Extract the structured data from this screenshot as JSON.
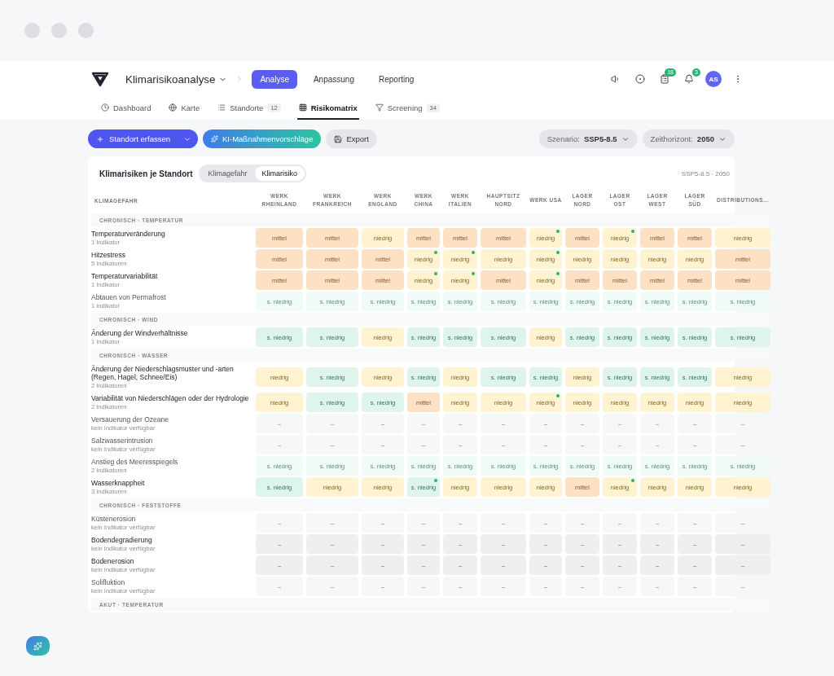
{
  "app": {
    "title": "Klimarisikoanalyse",
    "tabs": [
      {
        "label": "Analyse",
        "selected": true
      },
      {
        "label": "Anpassung",
        "selected": false
      },
      {
        "label": "Reporting",
        "selected": false
      }
    ],
    "badges": {
      "tasks": "18",
      "notifications": "3"
    },
    "avatar": "AS"
  },
  "subtabs": [
    {
      "label": "Dashboard",
      "selected": false
    },
    {
      "label": "Karte",
      "selected": false
    },
    {
      "label": "Standorte",
      "count": "12",
      "selected": false
    },
    {
      "label": "Risikomatrix",
      "selected": true
    },
    {
      "label": "Screening",
      "count": "34",
      "selected": false
    }
  ],
  "toolbar": {
    "add": "Standort erfassen",
    "ai": "KI-Maßnahmenvorschläge",
    "export": "Export",
    "scenario_label": "Szenario:",
    "scenario": "SSP5-8.5",
    "horizon_label": "Zeithorizont:",
    "horizon": "2050"
  },
  "card": {
    "title": "Klimarisiken je Standort",
    "toggle": [
      {
        "label": "Klimagefahr",
        "selected": false
      },
      {
        "label": "Klimarisiko",
        "selected": true
      }
    ],
    "meta": "SSP5-8.5 · 2050",
    "first_column": "KLIMAGEFAHR",
    "columns": [
      "WERK RHEINLAND",
      "WERK FRANKREICH",
      "WERK ENGLAND",
      "WERK CHINA",
      "WERK ITALIEN",
      "HAUPTSITZ NORD",
      "WERK USA",
      "LAGER NORD",
      "LAGER OST",
      "LAGER WEST",
      "LAGER SÜD",
      "DISTRIBUTIONS..."
    ],
    "groups": [
      {
        "title": "CHRONISCH · TEMPERATUR",
        "rows": [
          {
            "label": "Temperaturveränderung",
            "sub": "1 Indikator",
            "faded": false,
            "cells": [
              {
                "text": "mittel",
                "kind": "medium",
                "flag": false
              },
              {
                "text": "mittel",
                "kind": "medium",
                "flag": false
              },
              {
                "text": "niedrig",
                "kind": "low",
                "flag": false
              },
              {
                "text": "mittel",
                "kind": "medium",
                "flag": false
              },
              {
                "text": "mittel",
                "kind": "medium",
                "flag": false
              },
              {
                "text": "mittel",
                "kind": "medium",
                "flag": false
              },
              {
                "text": "niedrig",
                "kind": "low",
                "flag": true
              },
              {
                "text": "mittel",
                "kind": "medium",
                "flag": false
              },
              {
                "text": "niedrig",
                "kind": "low",
                "flag": true
              },
              {
                "text": "mittel",
                "kind": "medium",
                "flag": false
              },
              {
                "text": "mittel",
                "kind": "medium",
                "flag": false
              },
              {
                "text": "niedrig",
                "kind": "low",
                "flag": false
              }
            ]
          },
          {
            "label": "Hitzestress",
            "sub": "5 Indikatoren",
            "faded": false,
            "cells": [
              {
                "text": "mittel",
                "kind": "medium",
                "flag": false
              },
              {
                "text": "mittel",
                "kind": "medium",
                "flag": false
              },
              {
                "text": "mittel",
                "kind": "medium",
                "flag": false
              },
              {
                "text": "niedrig",
                "kind": "low",
                "flag": true
              },
              {
                "text": "niedrig",
                "kind": "low",
                "flag": true
              },
              {
                "text": "niedrig",
                "kind": "low",
                "flag": false
              },
              {
                "text": "niedrig",
                "kind": "low",
                "flag": true
              },
              {
                "text": "niedrig",
                "kind": "low",
                "flag": false
              },
              {
                "text": "niedrig",
                "kind": "low",
                "flag": false
              },
              {
                "text": "niedrig",
                "kind": "low",
                "flag": false
              },
              {
                "text": "niedrig",
                "kind": "low",
                "flag": false
              },
              {
                "text": "mittel",
                "kind": "medium",
                "flag": false
              }
            ]
          },
          {
            "label": "Temperaturvariabilität",
            "sub": "1 Indikator",
            "faded": false,
            "cells": [
              {
                "text": "mittel",
                "kind": "medium",
                "flag": false
              },
              {
                "text": "mittel",
                "kind": "medium",
                "flag": false
              },
              {
                "text": "mittel",
                "kind": "medium",
                "flag": false
              },
              {
                "text": "niedrig",
                "kind": "low",
                "flag": true
              },
              {
                "text": "niedrig",
                "kind": "low",
                "flag": true
              },
              {
                "text": "mittel",
                "kind": "medium",
                "flag": false
              },
              {
                "text": "niedrig",
                "kind": "low",
                "flag": true
              },
              {
                "text": "mittel",
                "kind": "medium",
                "flag": false
              },
              {
                "text": "mittel",
                "kind": "medium",
                "flag": false
              },
              {
                "text": "mittel",
                "kind": "medium",
                "flag": false
              },
              {
                "text": "mittel",
                "kind": "medium",
                "flag": false
              },
              {
                "text": "mittel",
                "kind": "medium",
                "flag": false
              }
            ]
          },
          {
            "label": "Abtauen von Permafrost",
            "sub": "1 Indikator",
            "faded": true,
            "cells": [
              {
                "text": "s. niedrig",
                "kind": "very_low",
                "flag": false
              },
              {
                "text": "s. niedrig",
                "kind": "very_low",
                "flag": false
              },
              {
                "text": "s. niedrig",
                "kind": "very_low",
                "flag": false
              },
              {
                "text": "s. niedrig",
                "kind": "very_low",
                "flag": false
              },
              {
                "text": "s. niedrig",
                "kind": "very_low",
                "flag": false
              },
              {
                "text": "s. niedrig",
                "kind": "very_low",
                "flag": false
              },
              {
                "text": "s. niedrig",
                "kind": "very_low",
                "flag": false
              },
              {
                "text": "s. niedrig",
                "kind": "very_low",
                "flag": false
              },
              {
                "text": "s. niedrig",
                "kind": "very_low",
                "flag": false
              },
              {
                "text": "s. niedrig",
                "kind": "very_low",
                "flag": false
              },
              {
                "text": "s. niedrig",
                "kind": "very_low",
                "flag": false
              },
              {
                "text": "s. niedrig",
                "kind": "very_low",
                "flag": false
              }
            ]
          }
        ]
      },
      {
        "title": "CHRONISCH · WIND",
        "rows": [
          {
            "label": "Änderung der Windverhältnisse",
            "sub": "1 Indikator",
            "faded": false,
            "cells": [
              {
                "text": "s. niedrig",
                "kind": "very_low",
                "flag": false
              },
              {
                "text": "s. niedrig",
                "kind": "very_low",
                "flag": false
              },
              {
                "text": "niedrig",
                "kind": "low",
                "flag": false
              },
              {
                "text": "s. niedrig",
                "kind": "very_low",
                "flag": false
              },
              {
                "text": "s. niedrig",
                "kind": "very_low",
                "flag": false
              },
              {
                "text": "s. niedrig",
                "kind": "very_low",
                "flag": false
              },
              {
                "text": "niedrig",
                "kind": "low",
                "flag": false
              },
              {
                "text": "s. niedrig",
                "kind": "very_low",
                "flag": false
              },
              {
                "text": "s. niedrig",
                "kind": "very_low",
                "flag": false
              },
              {
                "text": "s. niedrig",
                "kind": "very_low",
                "flag": false
              },
              {
                "text": "s. niedrig",
                "kind": "very_low",
                "flag": false
              },
              {
                "text": "s. niedrig",
                "kind": "very_low",
                "flag": false
              }
            ]
          }
        ]
      },
      {
        "title": "CHRONISCH · WASSER",
        "rows": [
          {
            "label": "Änderung der Niederschlagsmuster und -arten (Regen, Hagel, Schnee/Eis)",
            "sub": "2 Indikatoren",
            "faded": false,
            "cells": [
              {
                "text": "niedrig",
                "kind": "low",
                "flag": false
              },
              {
                "text": "s. niedrig",
                "kind": "very_low",
                "flag": false
              },
              {
                "text": "niedrig",
                "kind": "low",
                "flag": false
              },
              {
                "text": "s. niedrig",
                "kind": "very_low",
                "flag": false
              },
              {
                "text": "niedrig",
                "kind": "low",
                "flag": false
              },
              {
                "text": "s. niedrig",
                "kind": "very_low",
                "flag": false
              },
              {
                "text": "s. niedrig",
                "kind": "very_low",
                "flag": false
              },
              {
                "text": "niedrig",
                "kind": "low",
                "flag": false
              },
              {
                "text": "s. niedrig",
                "kind": "very_low",
                "flag": false
              },
              {
                "text": "s. niedrig",
                "kind": "very_low",
                "flag": false
              },
              {
                "text": "s. niedrig",
                "kind": "very_low",
                "flag": false
              },
              {
                "text": "niedrig",
                "kind": "low",
                "flag": false
              }
            ]
          },
          {
            "label": "Variabilität von Niederschlägen oder der Hydrologie",
            "sub": "2 Indikatoren",
            "faded": false,
            "cells": [
              {
                "text": "niedrig",
                "kind": "low",
                "flag": false
              },
              {
                "text": "s. niedrig",
                "kind": "very_low",
                "flag": false
              },
              {
                "text": "s. niedrig",
                "kind": "very_low",
                "flag": false
              },
              {
                "text": "mittel",
                "kind": "medium",
                "flag": false
              },
              {
                "text": "niedrig",
                "kind": "low",
                "flag": false
              },
              {
                "text": "niedrig",
                "kind": "low",
                "flag": false
              },
              {
                "text": "niedrig",
                "kind": "low",
                "flag": true
              },
              {
                "text": "niedrig",
                "kind": "low",
                "flag": false
              },
              {
                "text": "niedrig",
                "kind": "low",
                "flag": false
              },
              {
                "text": "niedrig",
                "kind": "low",
                "flag": false
              },
              {
                "text": "niedrig",
                "kind": "low",
                "flag": false
              },
              {
                "text": "niedrig",
                "kind": "low",
                "flag": false
              }
            ]
          },
          {
            "label": "Versauerung der Ozeane",
            "sub": "kein Indikator verfügbar",
            "faded": true,
            "cells": [
              {
                "text": "–",
                "kind": "none",
                "flag": false
              },
              {
                "text": "–",
                "kind": "none",
                "flag": false
              },
              {
                "text": "–",
                "kind": "none",
                "flag": false
              },
              {
                "text": "–",
                "kind": "none",
                "flag": false
              },
              {
                "text": "–",
                "kind": "none",
                "flag": false
              },
              {
                "text": "–",
                "kind": "none",
                "flag": false
              },
              {
                "text": "–",
                "kind": "none",
                "flag": false
              },
              {
                "text": "–",
                "kind": "none",
                "flag": false
              },
              {
                "text": "–",
                "kind": "none",
                "flag": false
              },
              {
                "text": "–",
                "kind": "none",
                "flag": false
              },
              {
                "text": "–",
                "kind": "none",
                "flag": false
              },
              {
                "text": "–",
                "kind": "none",
                "flag": false
              }
            ]
          },
          {
            "label": "Salzwasserintrusion",
            "sub": "kein Indikator verfügbar",
            "faded": true,
            "cells": [
              {
                "text": "–",
                "kind": "none",
                "flag": false
              },
              {
                "text": "–",
                "kind": "none",
                "flag": false
              },
              {
                "text": "–",
                "kind": "none",
                "flag": false
              },
              {
                "text": "–",
                "kind": "none",
                "flag": false
              },
              {
                "text": "–",
                "kind": "none",
                "flag": false
              },
              {
                "text": "–",
                "kind": "none",
                "flag": false
              },
              {
                "text": "–",
                "kind": "none",
                "flag": false
              },
              {
                "text": "–",
                "kind": "none",
                "flag": false
              },
              {
                "text": "–",
                "kind": "none",
                "flag": false
              },
              {
                "text": "–",
                "kind": "none",
                "flag": false
              },
              {
                "text": "–",
                "kind": "none",
                "flag": false
              },
              {
                "text": "–",
                "kind": "none",
                "flag": false
              }
            ]
          },
          {
            "label": "Anstieg des Meeresspiegels",
            "sub": "2 Indikatoren",
            "faded": true,
            "cells": [
              {
                "text": "s. niedrig",
                "kind": "very_low",
                "flag": false
              },
              {
                "text": "s. niedrig",
                "kind": "very_low",
                "flag": false
              },
              {
                "text": "s. niedrig",
                "kind": "very_low",
                "flag": false
              },
              {
                "text": "s. niedrig",
                "kind": "very_low",
                "flag": false
              },
              {
                "text": "s. niedrig",
                "kind": "very_low",
                "flag": false
              },
              {
                "text": "s. niedrig",
                "kind": "very_low",
                "flag": false
              },
              {
                "text": "s. niedrig",
                "kind": "very_low",
                "flag": false
              },
              {
                "text": "s. niedrig",
                "kind": "very_low",
                "flag": false
              },
              {
                "text": "s. niedrig",
                "kind": "very_low",
                "flag": false
              },
              {
                "text": "s. niedrig",
                "kind": "very_low",
                "flag": false
              },
              {
                "text": "s. niedrig",
                "kind": "very_low",
                "flag": false
              },
              {
                "text": "s. niedrig",
                "kind": "very_low",
                "flag": false
              }
            ]
          },
          {
            "label": "Wasserknappheit",
            "sub": "3 Indikatoren",
            "faded": false,
            "cells": [
              {
                "text": "s. niedrig",
                "kind": "very_low",
                "flag": false
              },
              {
                "text": "niedrig",
                "kind": "low",
                "flag": false
              },
              {
                "text": "niedrig",
                "kind": "low",
                "flag": false
              },
              {
                "text": "s. niedrig",
                "kind": "very_low",
                "flag": true
              },
              {
                "text": "niedrig",
                "kind": "low",
                "flag": false
              },
              {
                "text": "niedrig",
                "kind": "low",
                "flag": false
              },
              {
                "text": "niedrig",
                "kind": "low",
                "flag": false
              },
              {
                "text": "mittel",
                "kind": "medium",
                "flag": false
              },
              {
                "text": "niedrig",
                "kind": "low",
                "flag": true
              },
              {
                "text": "niedrig",
                "kind": "low",
                "flag": false
              },
              {
                "text": "niedrig",
                "kind": "low",
                "flag": false
              },
              {
                "text": "niedrig",
                "kind": "low",
                "flag": false
              }
            ]
          }
        ]
      },
      {
        "title": "CHRONISCH · FESTSTOFFE",
        "rows": [
          {
            "label": "Küstenerosion",
            "sub": "kein Indikator verfügbar",
            "faded": true,
            "cells": [
              {
                "text": "–",
                "kind": "none",
                "flag": false
              },
              {
                "text": "–",
                "kind": "none",
                "flag": false
              },
              {
                "text": "–",
                "kind": "none",
                "flag": false
              },
              {
                "text": "–",
                "kind": "none",
                "flag": false
              },
              {
                "text": "–",
                "kind": "none",
                "flag": false
              },
              {
                "text": "–",
                "kind": "none",
                "flag": false
              },
              {
                "text": "–",
                "kind": "none",
                "flag": false
              },
              {
                "text": "–",
                "kind": "none",
                "flag": false
              },
              {
                "text": "–",
                "kind": "none",
                "flag": false
              },
              {
                "text": "–",
                "kind": "none",
                "flag": false
              },
              {
                "text": "–",
                "kind": "none",
                "flag": false
              },
              {
                "text": "–",
                "kind": "none",
                "flag": false
              }
            ]
          },
          {
            "label": "Bodendegradierung",
            "sub": "kein Indikator verfügbar",
            "faded": false,
            "cells": [
              {
                "text": "–",
                "kind": "none",
                "flag": false
              },
              {
                "text": "–",
                "kind": "none",
                "flag": false
              },
              {
                "text": "–",
                "kind": "none",
                "flag": false
              },
              {
                "text": "–",
                "kind": "none",
                "flag": false
              },
              {
                "text": "–",
                "kind": "none",
                "flag": false
              },
              {
                "text": "–",
                "kind": "none",
                "flag": false
              },
              {
                "text": "–",
                "kind": "none",
                "flag": false
              },
              {
                "text": "–",
                "kind": "none",
                "flag": false
              },
              {
                "text": "–",
                "kind": "none",
                "flag": false
              },
              {
                "text": "–",
                "kind": "none",
                "flag": false
              },
              {
                "text": "–",
                "kind": "none",
                "flag": false
              },
              {
                "text": "–",
                "kind": "none",
                "flag": false
              }
            ]
          },
          {
            "label": "Bodenerosion",
            "sub": "kein Indikator verfügbar",
            "faded": false,
            "cells": [
              {
                "text": "–",
                "kind": "none",
                "flag": false
              },
              {
                "text": "–",
                "kind": "none",
                "flag": false
              },
              {
                "text": "–",
                "kind": "none",
                "flag": false
              },
              {
                "text": "–",
                "kind": "none",
                "flag": false
              },
              {
                "text": "–",
                "kind": "none",
                "flag": false
              },
              {
                "text": "–",
                "kind": "none",
                "flag": false
              },
              {
                "text": "–",
                "kind": "none",
                "flag": false
              },
              {
                "text": "–",
                "kind": "none",
                "flag": false
              },
              {
                "text": "–",
                "kind": "none",
                "flag": false
              },
              {
                "text": "–",
                "kind": "none",
                "flag": false
              },
              {
                "text": "–",
                "kind": "none",
                "flag": false
              },
              {
                "text": "–",
                "kind": "none",
                "flag": false
              }
            ]
          },
          {
            "label": "Solifluktion",
            "sub": "kein Indikator verfügbar",
            "faded": true,
            "cells": [
              {
                "text": "–",
                "kind": "none",
                "flag": false
              },
              {
                "text": "–",
                "kind": "none",
                "flag": false
              },
              {
                "text": "–",
                "kind": "none",
                "flag": false
              },
              {
                "text": "–",
                "kind": "none",
                "flag": false
              },
              {
                "text": "–",
                "kind": "none",
                "flag": false
              },
              {
                "text": "–",
                "kind": "none",
                "flag": false
              },
              {
                "text": "–",
                "kind": "none",
                "flag": false
              },
              {
                "text": "–",
                "kind": "none",
                "flag": false
              },
              {
                "text": "–",
                "kind": "none",
                "flag": false
              },
              {
                "text": "–",
                "kind": "none",
                "flag": false
              },
              {
                "text": "–",
                "kind": "none",
                "flag": false
              },
              {
                "text": "–",
                "kind": "none",
                "flag": false
              }
            ]
          }
        ]
      },
      {
        "title": "AKUT · TEMPERATUR"
      }
    ]
  }
}
